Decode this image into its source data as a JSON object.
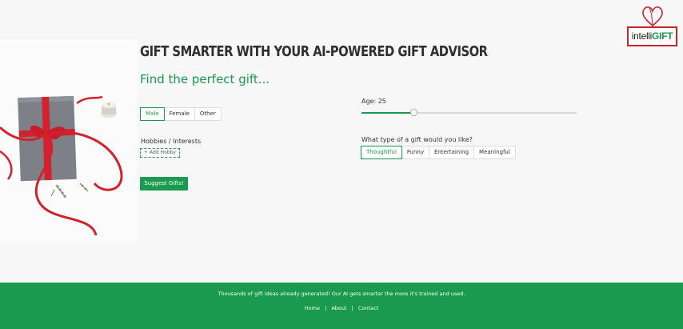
{
  "brand": {
    "logo_part1": "intelli",
    "logo_part2": "GIFT",
    "red": "#c8262c",
    "green": "#1a9a4e"
  },
  "hero": {
    "image": "gift-box-with-red-ribbon"
  },
  "main": {
    "title": "GIFT SMARTER WITH YOUR AI-POWERED GIFT ADVISOR",
    "subtitle": "Find the perfect gift...",
    "gender_options": [
      "Male",
      "Female",
      "Other"
    ],
    "gender_selected": "Male",
    "hobbies_label": "Hobbies / Interests",
    "add_hobby_label": "Add Hobby",
    "age_label": "Age: 25",
    "age_value": 25,
    "age_slider_fraction": 0.24,
    "gift_type_label": "What type of a gift would you like?",
    "gift_type_options": [
      "Thoughtful",
      "Funny",
      "Entertaining",
      "Meaningful"
    ],
    "gift_type_selected": "Thoughtful",
    "suggest_label": "Suggest Gifts!"
  },
  "footer": {
    "text": "Thousands of gift ideas already generated! Our AI gets smarter the more it's trained and used.",
    "links": [
      "Home",
      "About",
      "Contact"
    ],
    "separator": "|"
  }
}
